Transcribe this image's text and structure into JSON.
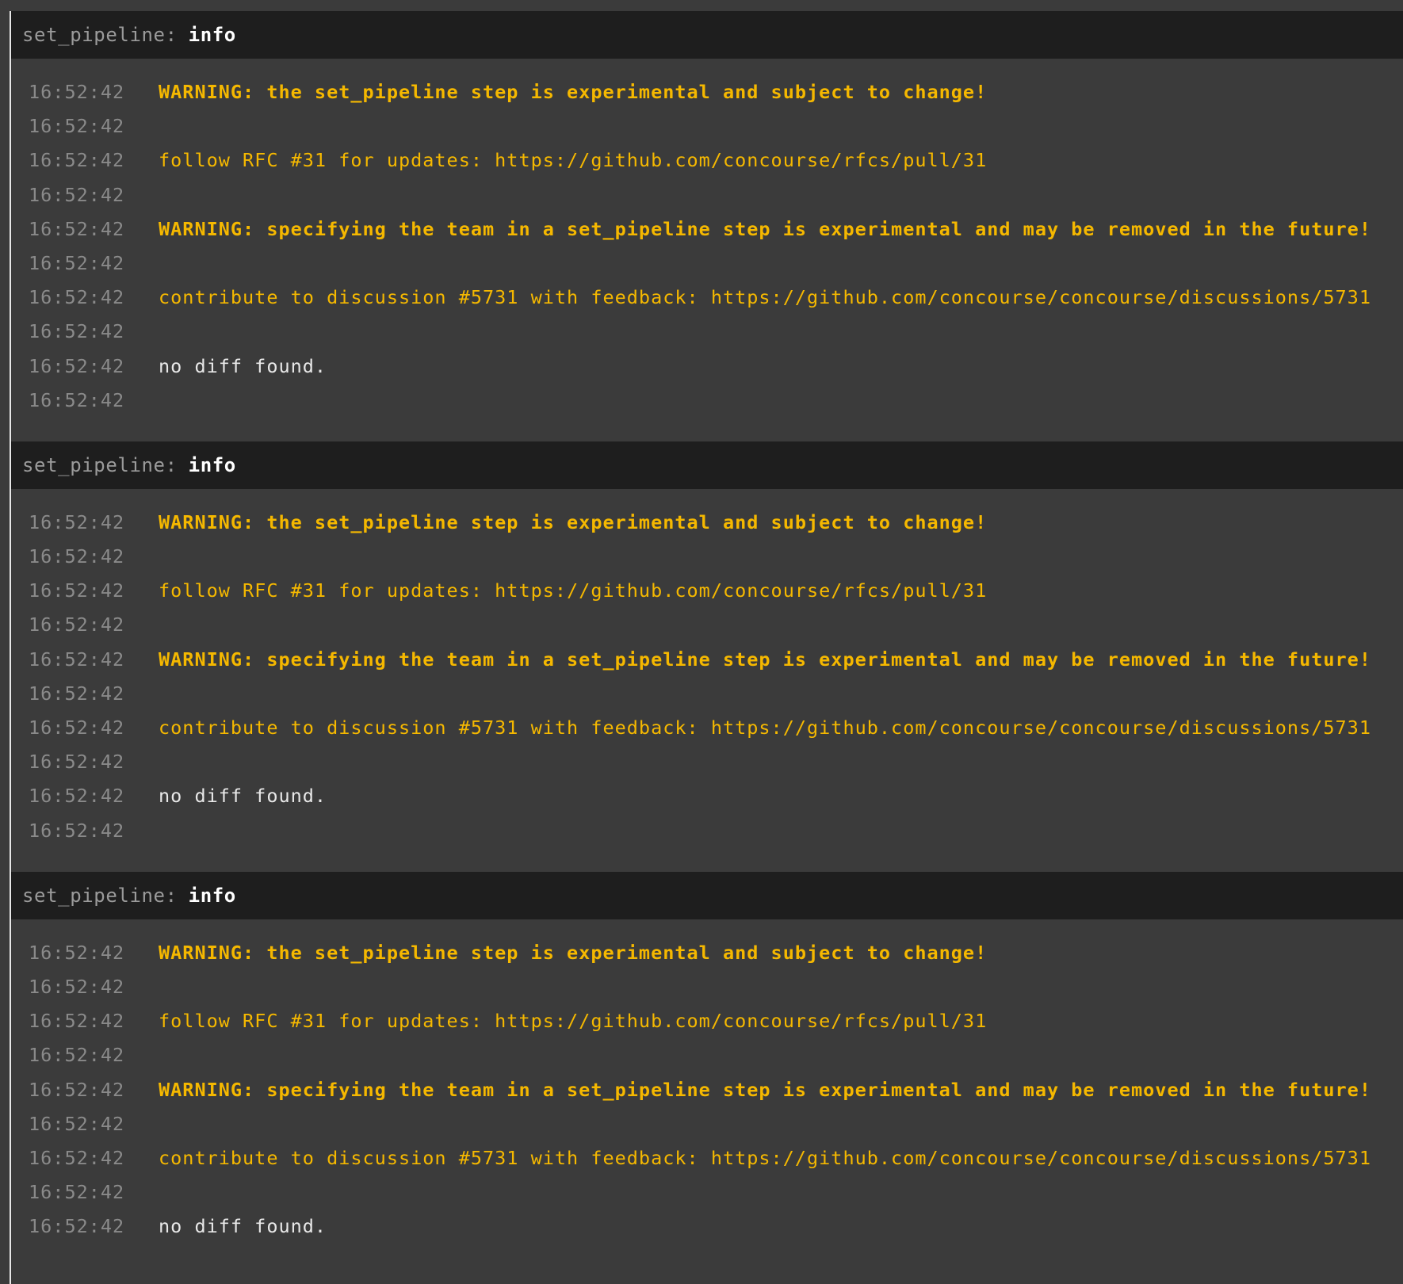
{
  "sections": [
    {
      "step": "set_pipeline",
      "separator": ":",
      "status": "info",
      "lines": [
        {
          "time": "16:52:42",
          "text": "WARNING: the set_pipeline step is experimental and subject to change!",
          "kind": "warn"
        },
        {
          "time": "16:52:42",
          "text": "",
          "kind": "plain"
        },
        {
          "time": "16:52:42",
          "text": "follow RFC #31 for updates: https://github.com/concourse/rfcs/pull/31",
          "kind": "info"
        },
        {
          "time": "16:52:42",
          "text": "",
          "kind": "plain"
        },
        {
          "time": "16:52:42",
          "text": "WARNING: specifying the team in a set_pipeline step is experimental and may be removed in the future!",
          "kind": "warn"
        },
        {
          "time": "16:52:42",
          "text": "",
          "kind": "plain"
        },
        {
          "time": "16:52:42",
          "text": "contribute to discussion #5731 with feedback: https://github.com/concourse/concourse/discussions/5731",
          "kind": "info"
        },
        {
          "time": "16:52:42",
          "text": "",
          "kind": "plain"
        },
        {
          "time": "16:52:42",
          "text": "no diff found.",
          "kind": "plain"
        },
        {
          "time": "16:52:42",
          "text": "",
          "kind": "plain"
        }
      ]
    },
    {
      "step": "set_pipeline",
      "separator": ":",
      "status": "info",
      "lines": [
        {
          "time": "16:52:42",
          "text": "WARNING: the set_pipeline step is experimental and subject to change!",
          "kind": "warn"
        },
        {
          "time": "16:52:42",
          "text": "",
          "kind": "plain"
        },
        {
          "time": "16:52:42",
          "text": "follow RFC #31 for updates: https://github.com/concourse/rfcs/pull/31",
          "kind": "info"
        },
        {
          "time": "16:52:42",
          "text": "",
          "kind": "plain"
        },
        {
          "time": "16:52:42",
          "text": "WARNING: specifying the team in a set_pipeline step is experimental and may be removed in the future!",
          "kind": "warn"
        },
        {
          "time": "16:52:42",
          "text": "",
          "kind": "plain"
        },
        {
          "time": "16:52:42",
          "text": "contribute to discussion #5731 with feedback: https://github.com/concourse/concourse/discussions/5731",
          "kind": "info"
        },
        {
          "time": "16:52:42",
          "text": "",
          "kind": "plain"
        },
        {
          "time": "16:52:42",
          "text": "no diff found.",
          "kind": "plain"
        },
        {
          "time": "16:52:42",
          "text": "",
          "kind": "plain"
        }
      ]
    },
    {
      "step": "set_pipeline",
      "separator": ":",
      "status": "info",
      "lines": [
        {
          "time": "16:52:42",
          "text": "WARNING: the set_pipeline step is experimental and subject to change!",
          "kind": "warn"
        },
        {
          "time": "16:52:42",
          "text": "",
          "kind": "plain"
        },
        {
          "time": "16:52:42",
          "text": "follow RFC #31 for updates: https://github.com/concourse/rfcs/pull/31",
          "kind": "info"
        },
        {
          "time": "16:52:42",
          "text": "",
          "kind": "plain"
        },
        {
          "time": "16:52:42",
          "text": "WARNING: specifying the team in a set_pipeline step is experimental and may be removed in the future!",
          "kind": "warn"
        },
        {
          "time": "16:52:42",
          "text": "",
          "kind": "plain"
        },
        {
          "time": "16:52:42",
          "text": "contribute to discussion #5731 with feedback: https://github.com/concourse/concourse/discussions/5731",
          "kind": "info"
        },
        {
          "time": "16:52:42",
          "text": "",
          "kind": "plain"
        },
        {
          "time": "16:52:42",
          "text": "no diff found.",
          "kind": "plain"
        }
      ]
    }
  ],
  "colors": {
    "background": "#3b3b3b",
    "header_background": "#1e1e1e",
    "warning": "#f5b800",
    "timestamp": "#8a8a8a",
    "plain_text": "#e8e8e8"
  }
}
